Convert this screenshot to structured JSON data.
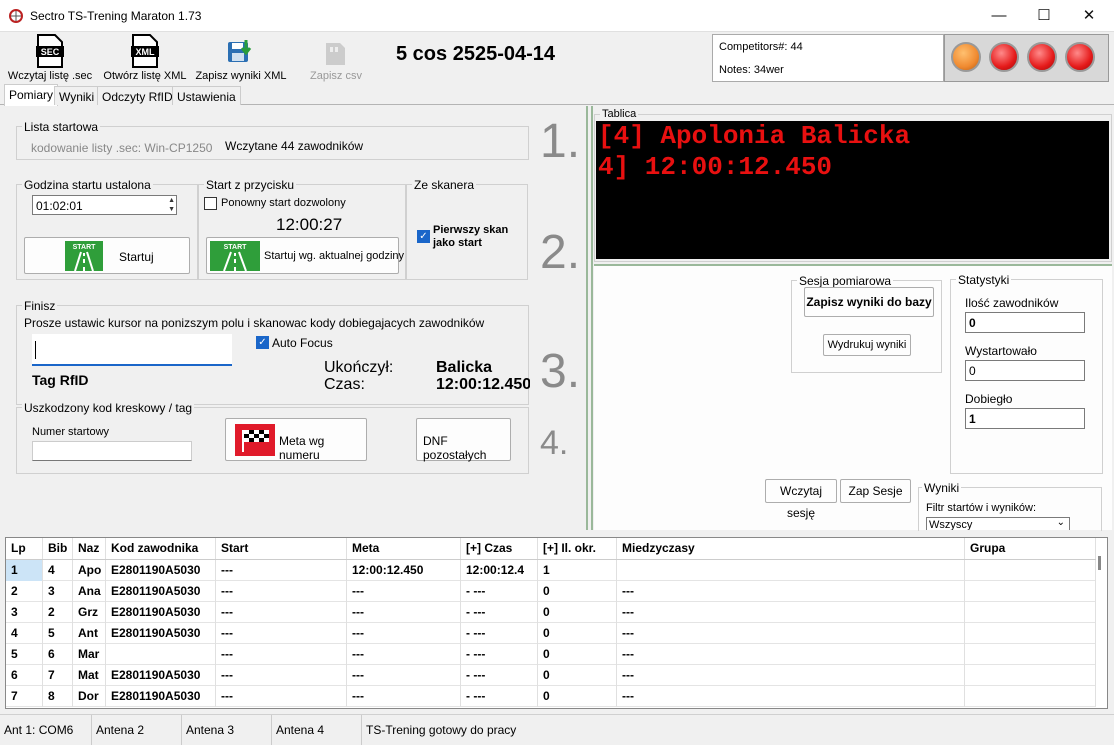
{
  "window": {
    "title": "Sectro TS-Trening Maraton 1.73",
    "minimize": "—",
    "maximize": "☐",
    "close": "✕"
  },
  "toolbar": {
    "load_sec": "Wczytaj listę .sec",
    "open_xml": "Otwórz listę XML",
    "save_xml": "Zapisz wyniki XML",
    "save_csv": "Zapisz csv",
    "sec_icon_text": "SEC",
    "xml_icon_text": "XML"
  },
  "header": {
    "date": "5 cos 2525-04-14",
    "competitors": "Competitors#: 44",
    "notes": "Notes: 34wer"
  },
  "tabs": [
    "Pomiary",
    "Wyniki",
    "Odczyty RfID",
    "Ustawienia"
  ],
  "start_list": {
    "legend": "Lista startowa",
    "encoding": "kodowanie listy .sec: Win-CP1250",
    "loaded": "Wczytane 44 zawodników",
    "step": "1."
  },
  "start_time": {
    "legend": "Godzina startu ustalona",
    "time_value": "01:02:01",
    "start_button": "Startuj",
    "start_icon_text": "START"
  },
  "button_start": {
    "legend": "Start z przycisku",
    "restart_label": "Ponowny start dozwolony",
    "clock": "12:00:27",
    "start_now_button": "Startuj wg. aktualnej godziny"
  },
  "scanner": {
    "legend": "Ze skanera",
    "first_scan_label": "Pierwszy skan jako start",
    "step": "2."
  },
  "finish": {
    "legend": "Finisz",
    "instruction": "Prosze ustawic kursor na ponizszym polu i skanowac kody dobiegajacych zawodników",
    "tag_label": "Tag RfID",
    "auto_focus": "Auto Focus",
    "finished_label": "Ukończył:",
    "finished_value": "Balicka",
    "time_label": "Czas:",
    "time_value": "12:00:12.450",
    "step": "3."
  },
  "damaged": {
    "legend": "Uszkodzony kod kreskowy / tag",
    "bib_label": "Numer startowy",
    "finish_by_number": "Meta wg numeru",
    "dnf_button": "DNF pozostałych",
    "step": "4."
  },
  "board": {
    "legend": "Tablica",
    "line1": "[4] Apolonia Balicka",
    "line2": "4] 12:00:12.450"
  },
  "session": {
    "legend": "Sesja pomiarowa",
    "save_db": "Zapisz wyniki do bazy",
    "print": "Wydrukuj wyniki",
    "load_session": "Wczytaj sesję",
    "save_session": "Zap Sesje"
  },
  "stats": {
    "legend": "Statystyki",
    "count_label": "Ilość zawodników",
    "count_value": "0",
    "started_label": "Wystartowało",
    "started_value": "0",
    "finished_label": "Dobiegło",
    "finished_value": "1"
  },
  "results": {
    "legend": "Wyniki",
    "filter_label": "Filtr startów i wyników:",
    "filter_value": "Wszyscy"
  },
  "table": {
    "columns": [
      "Lp",
      "Bib",
      "Naz",
      "Kod zawodnika",
      "Start",
      "Meta",
      "[+] Czas",
      "[+] Il. okr.",
      "Miedzyczasy",
      "Grupa"
    ],
    "rows": [
      [
        "1",
        "4",
        "Apo",
        "E2801190A5030",
        "---",
        "12:00:12.450",
        "12:00:12.4",
        "1",
        "",
        ""
      ],
      [
        "2",
        "3",
        "Ana",
        "E2801190A5030",
        "---",
        "---",
        "- ---",
        "0",
        "---",
        ""
      ],
      [
        "3",
        "2",
        "Grz",
        "E2801190A5030",
        "---",
        "---",
        "- ---",
        "0",
        "---",
        ""
      ],
      [
        "4",
        "5",
        "Ant",
        "E2801190A5030",
        "---",
        "---",
        "- ---",
        "0",
        "---",
        ""
      ],
      [
        "5",
        "6",
        "Mar",
        "",
        "---",
        "---",
        "- ---",
        "0",
        "---",
        ""
      ],
      [
        "6",
        "7",
        "Mat",
        "E2801190A5030",
        "---",
        "---",
        "- ---",
        "0",
        "---",
        ""
      ],
      [
        "7",
        "8",
        "Dor",
        "E2801190A5030",
        "---",
        "---",
        "- ---",
        "0",
        "---",
        ""
      ]
    ]
  },
  "status": [
    "Ant 1: COM6",
    "Antena 2",
    "Antena 3",
    "Antena 4",
    "TS-Trening gotowy do pracy"
  ],
  "colors": {
    "board_bg": "#000000",
    "board_text": "#e81010",
    "start_green": "#2f9e3a",
    "light_orange": "#f08a30",
    "light_red": "#e51a1a"
  }
}
